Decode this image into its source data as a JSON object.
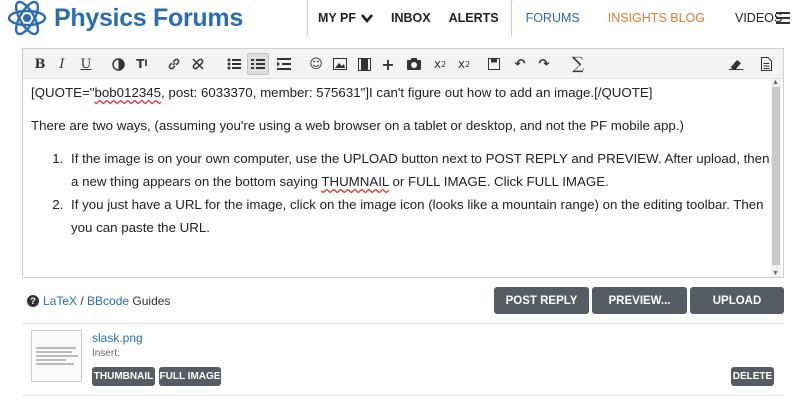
{
  "site": {
    "name": "Physics Forums"
  },
  "nav": [
    {
      "label": "MY PF"
    },
    {
      "label": "INBOX"
    },
    {
      "label": "ALERTS"
    },
    {
      "label": "FORUMS"
    },
    {
      "label": "INSIGHTS BLOG"
    },
    {
      "label": "VIDEOS"
    }
  ],
  "editor": {
    "quote_prefix": "[QUOTE=\"",
    "quote_user": "bob012345",
    "quote_rest": ", post: 6033370, member: 575631\"]I can't figure out how to add an image.[/QUOTE]",
    "para1": "There are two ways, (assuming you're using a web browser on a tablet or desktop, and not the PF mobile app.)",
    "item1_a": "If the image is on your own computer, use the UPLOAD button next to POST REPLY and PREVIEW.  After upload, then a new thing appears on the bottom saying ",
    "item1_b": "THUMNAIL",
    "item1_c": " or FULL IMAGE.  Click FULL IMAGE.",
    "item2": "If you just have a URL for the image, click on the image icon (looks like a mountain range) on the editing toolbar.  Then you can paste the URL."
  },
  "guides": {
    "latex": "LaTeX",
    "sep": " / ",
    "bbcode": "BBcode",
    "suffix": " Guides"
  },
  "buttons": {
    "post_reply": "POST REPLY",
    "preview": "PREVIEW...",
    "upload": "UPLOAD"
  },
  "attachment": {
    "filename": "slask.png",
    "insert_label": "Insert:",
    "thumbnail_btn": "THUMBNAIL",
    "full_image_btn": "FULL IMAGE",
    "delete_btn": "DELETE"
  },
  "colors": {
    "brand": "#2a6db0",
    "insights": "#e07a2f",
    "button": "#555c63"
  }
}
